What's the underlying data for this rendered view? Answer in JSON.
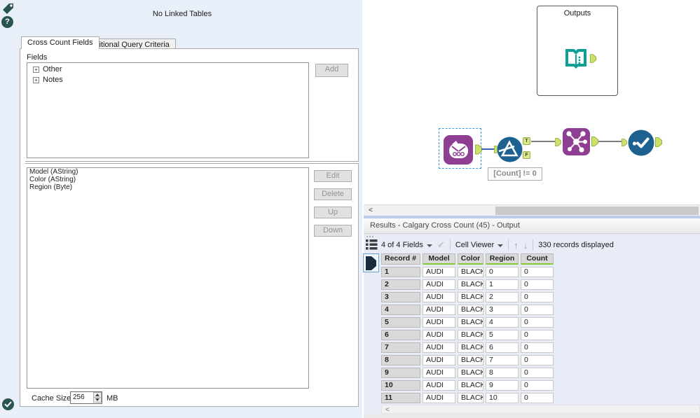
{
  "icons": {
    "question": "?",
    "left_arrow": "<",
    "check": "✔",
    "arrow_up": "↑",
    "arrow_down": "↓",
    "tree_expand": "+"
  },
  "config_panel": {
    "header": "No Linked Tables",
    "tabs": {
      "cross_count": "Cross Count Fields",
      "additional": "Additional Query Criteria"
    },
    "fields_label": "Fields",
    "tree_items": [
      "Other",
      "Notes"
    ],
    "add_button": "Add",
    "selected_fields": [
      "Model (AString)",
      "Color (AString)",
      "Region (Byte)"
    ],
    "edit_button": "Edit",
    "delete_button": "Delete",
    "up_button": "Up",
    "down_button": "Down",
    "cache_label": "Cache Size:",
    "cache_value": "256",
    "cache_unit": "MB"
  },
  "canvas": {
    "container_title": "Outputs",
    "annotation": "[Count] != 0",
    "anchor_true": "T",
    "anchor_false": "F"
  },
  "results": {
    "title": "Results - Calgary Cross Count (45) - Output",
    "toolbar": {
      "fields_dropdown": "4 of 4 Fields",
      "cell_viewer": "Cell Viewer",
      "records": "330 records displayed"
    },
    "table": {
      "columns": [
        "Record #",
        "Model",
        "Color",
        "Region",
        "Count"
      ],
      "rows": [
        [
          "1",
          "AUDI",
          "BLACK",
          "0",
          "0"
        ],
        [
          "2",
          "AUDI",
          "BLACK",
          "1",
          "0"
        ],
        [
          "3",
          "AUDI",
          "BLACK",
          "2",
          "0"
        ],
        [
          "4",
          "AUDI",
          "BLACK",
          "3",
          "0"
        ],
        [
          "5",
          "AUDI",
          "BLACK",
          "4",
          "0"
        ],
        [
          "6",
          "AUDI",
          "BLACK",
          "5",
          "0"
        ],
        [
          "7",
          "AUDI",
          "BLACK",
          "6",
          "0"
        ],
        [
          "8",
          "AUDI",
          "BLACK",
          "7",
          "0"
        ],
        [
          "9",
          "AUDI",
          "BLACK",
          "8",
          "0"
        ],
        [
          "10",
          "AUDI",
          "BLACK",
          "9",
          "0"
        ],
        [
          "11",
          "AUDI",
          "BLACK",
          "10",
          "0"
        ]
      ]
    }
  },
  "colors": {
    "purple": "#8E3F93",
    "tool_blue": "#1D6191",
    "teal": "#0AA096",
    "anchor_green": "#CCE06B",
    "anchor_border": "#94B23C",
    "header_green": "#85CB33",
    "dark_teal": "#2A554E"
  }
}
